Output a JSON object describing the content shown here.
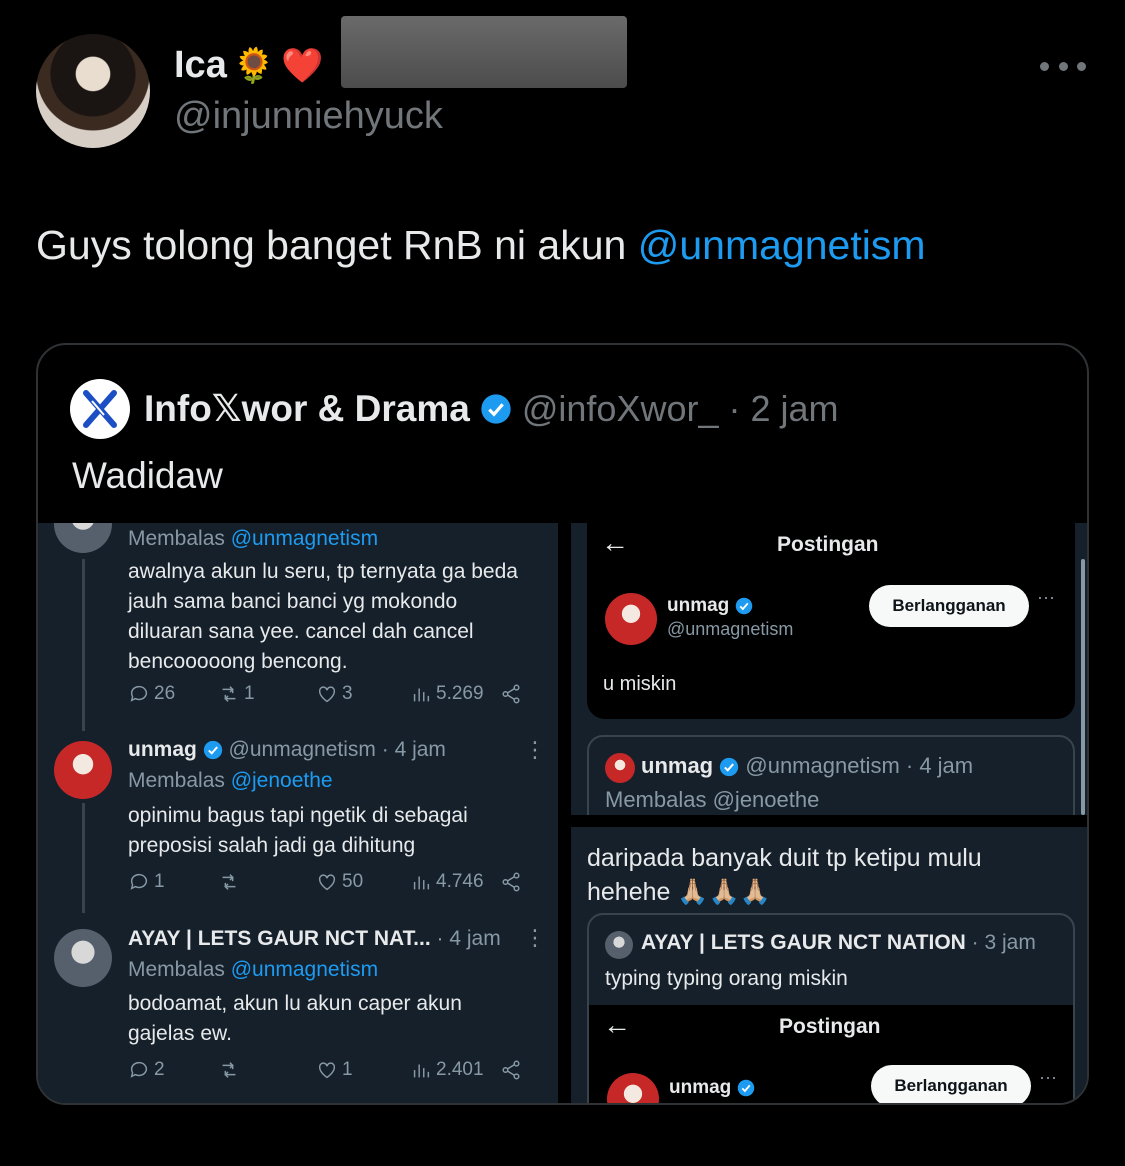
{
  "author": {
    "display_name": "Ica",
    "emojis": [
      "🌻",
      "❤️"
    ],
    "handle": "@injunniehyuck"
  },
  "tweet": {
    "text": "Guys tolong banget RnB ni akun ",
    "mention": "@unmagnetism"
  },
  "quote": {
    "name": "Info𝕏wor & Drama",
    "handle": "@infoXwor_",
    "time": "· 2 jam",
    "text": "Wadidaw"
  },
  "left_screenshot": {
    "reply1": {
      "replying_prefix": "Membalas ",
      "replying_to": "@unmagnetism",
      "lines": [
        "awalnya akun lu seru, tp ternyata ga beda",
        "jauh sama banci banci yg mokondo",
        "diluaran sana yee. cancel dah cancel",
        "bencooooong bencong."
      ],
      "replies": "26",
      "reposts": "1",
      "likes": "3",
      "views": "5.269"
    },
    "reply2": {
      "name": "unmag",
      "handle": "@unmagnetism · 4 jam",
      "replying_prefix": "Membalas ",
      "replying_to": "@jenoethe",
      "lines": [
        "opinimu bagus tapi ngetik di sebagai",
        "preposisi salah jadi ga dihitung"
      ],
      "replies": "1",
      "likes": "50",
      "views": "4.746"
    },
    "reply3": {
      "name": "AYAY | LETS GAUR NCT NAT...",
      "time": "· 4 jam",
      "replying_prefix": "Membalas ",
      "replying_to": "@unmagnetism",
      "lines": [
        "bodoamat, akun lu akun caper akun",
        "gajelas ew."
      ],
      "replies": "2",
      "likes": "1",
      "views": "2.401"
    }
  },
  "right_top": {
    "header_title": "Postingan",
    "name": "unmag",
    "handle": "@unmagnetism",
    "subscribe_label": "Berlangganan",
    "post_text": "u miskin",
    "reply_name": "unmag",
    "reply_handle": "@unmagnetism · 4 jam",
    "reply_replying": "Membalas @jenoethe"
  },
  "right_bottom": {
    "text_line1": "daripada banyak duit tp ketipu mulu",
    "text_line2": "hehehe 🙏🏼🙏🏼🙏🏼",
    "quoted_name": "AYAY | LETS GAUR NCT NATION",
    "quoted_time": "· 3 jam",
    "quoted_text": "typing typing orang miskin",
    "header_title": "Postingan",
    "name": "unmag",
    "subscribe_label": "Berlangganan"
  },
  "colors": {
    "background": "#000000",
    "accent": "#1d9bf0",
    "dim_text": "#71767b",
    "screenshot_bg": "#15202b"
  }
}
